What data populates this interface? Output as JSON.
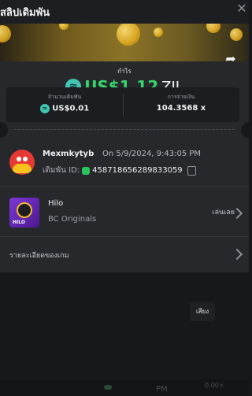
{
  "header": {
    "title": "สลิปเดิมพัน",
    "close_icon": "close-icon"
  },
  "summary": {
    "profit_label": "กำไร",
    "profit_amount": "US$1.12",
    "profit_currency": "ZIL",
    "currency_icon": "zil-coin-icon",
    "profit_color": "#35d66a",
    "share_icon": "share-arrow-icon",
    "bet_amount_label": "จำนวนเดิมพัน",
    "bet_amount_value": "US$0.01",
    "payout_label": "การจ่ายเงิน",
    "payout_value": "104.3568 x"
  },
  "bet": {
    "username": "Mexmkytyb",
    "time": "On 5/9/2024, 9:43:05 PM",
    "bet_id_label": "เดิมพัน ID:",
    "bet_id": "458718656289833059",
    "verified_icon": "shield-check-icon",
    "copy_icon": "copy-icon"
  },
  "game": {
    "name": "Hilo",
    "provider": "BC Originals",
    "thumb_tag": "HILO",
    "play_label": "เล่นเลย"
  },
  "details": {
    "label": "รายละเอียดของเกม"
  },
  "tooltip": {
    "label": "เสียง"
  },
  "background": {
    "ghost_text_1": "PM",
    "ghost_text_2": "0.00×"
  }
}
